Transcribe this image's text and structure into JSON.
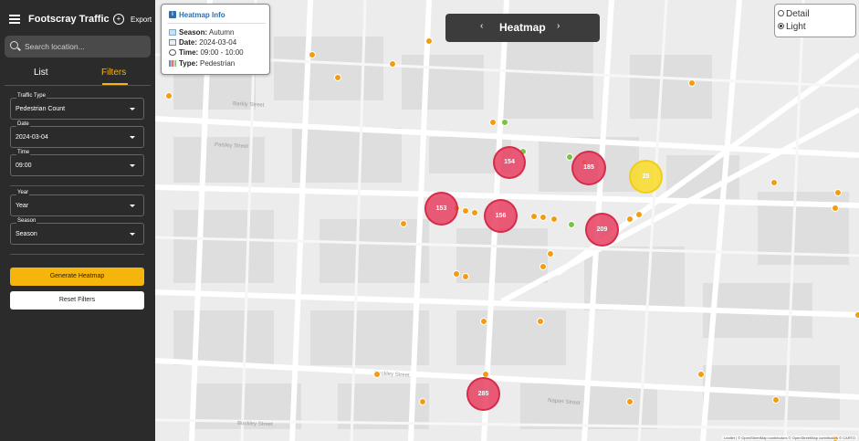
{
  "app": {
    "title": "Footscray Traffic",
    "export_label": "Export"
  },
  "search": {
    "placeholder": "Search location..."
  },
  "tabs": {
    "list": "List",
    "filters": "Filters"
  },
  "filters": {
    "traffic_type": {
      "label": "Traffic Type",
      "value": "Pedestrian Count"
    },
    "date": {
      "label": "Date",
      "value": "2024-03-04"
    },
    "time": {
      "label": "Time",
      "value": "09:00"
    },
    "year": {
      "label": "Year",
      "value": "Year"
    },
    "season": {
      "label": "Season",
      "value": "Season"
    }
  },
  "buttons": {
    "generate": "Generate Heatmap",
    "reset": "Reset Filters"
  },
  "info": {
    "title": "Heatmap Info",
    "season_key": "Season:",
    "season_val": "Autumn",
    "date_key": "Date:",
    "date_val": "2024-03-04",
    "time_key": "Time:",
    "time_val": "09:00 - 10:00",
    "type_key": "Type:",
    "type_val": "Pedestrian"
  },
  "heatmap_bar": {
    "prev": "‹",
    "title": "Heatmap",
    "next": "›"
  },
  "layers": {
    "detail": "Detail",
    "light": "Light",
    "selected": "Light"
  },
  "clusters": {
    "c1": "154",
    "c2": "153",
    "c3": "156",
    "c4": "185",
    "c5": "25",
    "c6": "209",
    "c7": "285"
  },
  "attribution": "Leaflet | © OpenStreetMap contributors © OpenStreetMap contributors © CARTO",
  "colors": {
    "accent": "#f5b50d",
    "cluster_red": "#e84060",
    "cluster_yellow": "#fadc28",
    "info_blue": "#2a6fb5"
  }
}
